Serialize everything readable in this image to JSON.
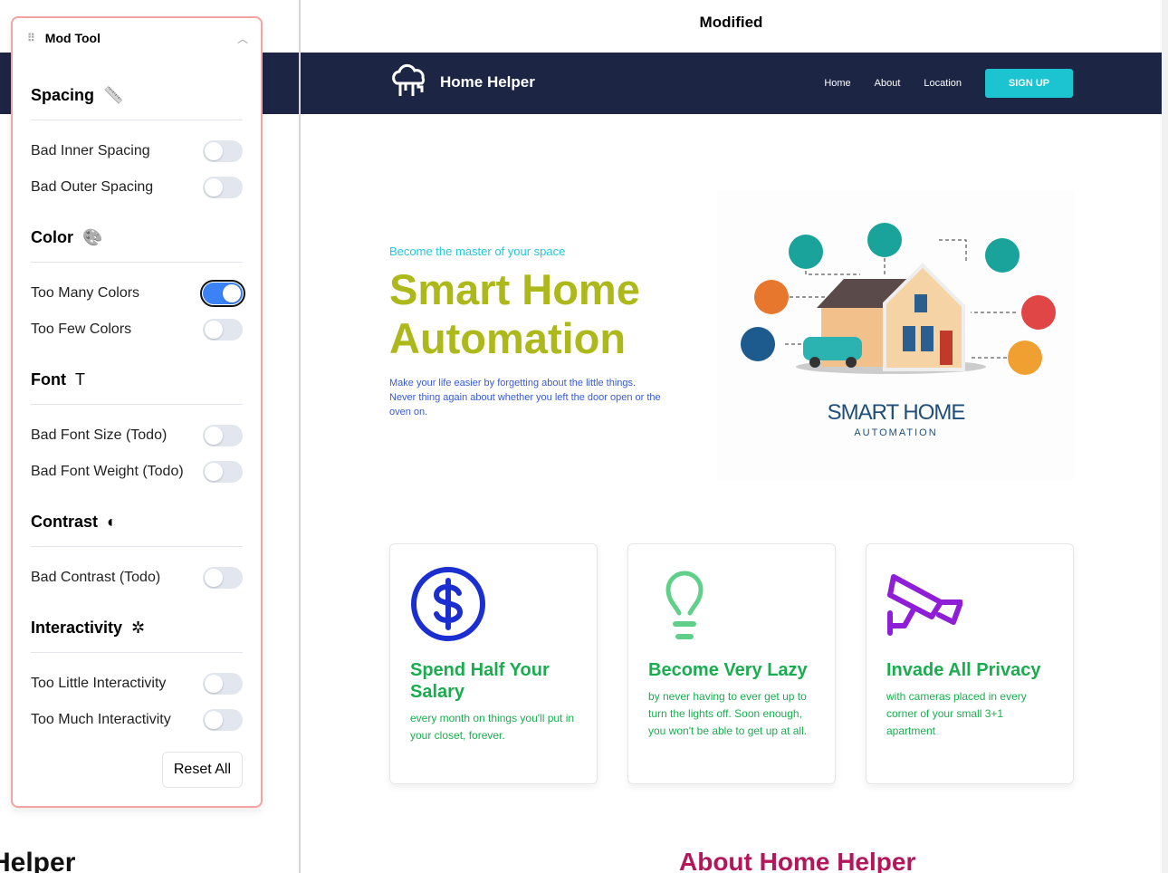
{
  "panel": {
    "title": "Mod Tool",
    "reset": "Reset All",
    "sections": [
      {
        "title": "Spacing",
        "icon": "ruler-icon",
        "items": [
          {
            "label": "Bad Inner Spacing",
            "on": false
          },
          {
            "label": "Bad Outer Spacing",
            "on": false
          }
        ]
      },
      {
        "title": "Color",
        "icon": "palette-icon",
        "items": [
          {
            "label": "Too Many Colors",
            "on": true
          },
          {
            "label": "Too Few Colors",
            "on": false
          }
        ]
      },
      {
        "title": "Font",
        "icon": "text-icon",
        "items": [
          {
            "label": "Bad Font Size (Todo)",
            "on": false
          },
          {
            "label": "Bad Font Weight (Todo)",
            "on": false
          }
        ]
      },
      {
        "title": "Contrast",
        "icon": "contrast-icon",
        "items": [
          {
            "label": "Bad Contrast (Todo)",
            "on": false
          }
        ]
      },
      {
        "title": "Interactivity",
        "icon": "pointer-click-icon",
        "items": [
          {
            "label": "Too Little Interactivity",
            "on": false
          },
          {
            "label": "Too Much Interactivity",
            "on": false
          }
        ]
      }
    ]
  },
  "background": {
    "heading_fragment": "Helper"
  },
  "frame": {
    "title": "Modified",
    "nav": {
      "brand": "Home Helper",
      "links": [
        "Home",
        "About",
        "Location"
      ],
      "cta": "SIGN UP"
    },
    "hero": {
      "eyebrow": "Become the master of your space",
      "title": "Smart Home Automation",
      "lead": "Make your life easier by forgetting about the little things. Never thing again about whether you left the door open or the oven on.",
      "illustration_title": "SMART HOME",
      "illustration_sub": "AUTOMATION"
    },
    "cards": [
      {
        "title": "Spend Half Your Salary",
        "text": "every month on things you'll put in your closet, forever."
      },
      {
        "title": "Become Very Lazy",
        "text": "by never having to ever get up to turn the lights off. Soon enough, you won't be able to get up at all."
      },
      {
        "title": "Invade All Privacy",
        "text": "with cameras placed in every corner of your small 3+1 apartment"
      }
    ],
    "about_title": "About Home Helper"
  },
  "colors": {
    "navy": "#1c2544",
    "accent": "#1cc3d0",
    "heading": "#adb81b",
    "card_text": "#1aad4f",
    "about": "#b3175a",
    "toggle_on": "#3b82f6"
  }
}
